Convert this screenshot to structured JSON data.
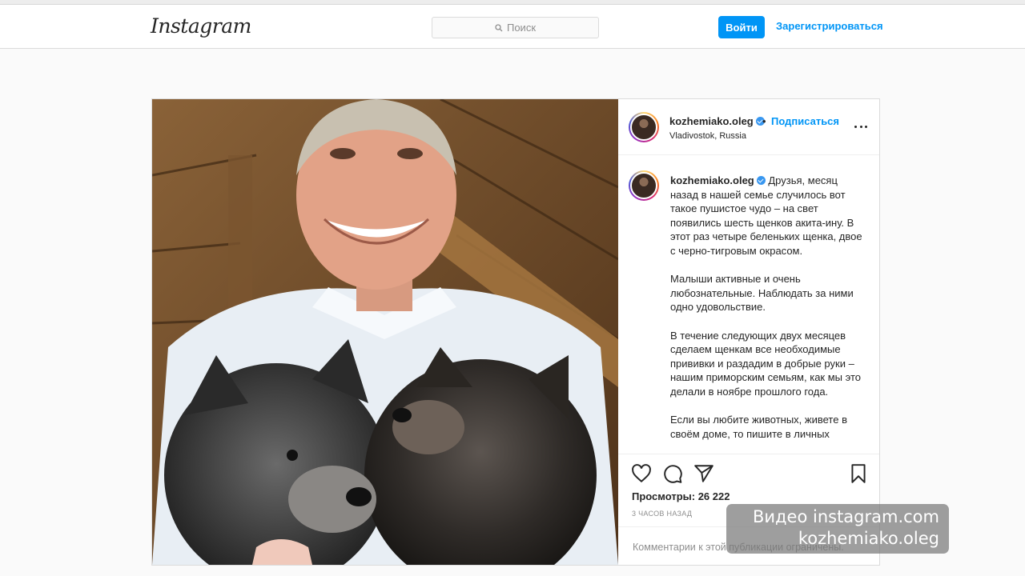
{
  "header": {
    "logo": "Instagram",
    "search": {
      "placeholder": "Поиск",
      "icon": "search-icon"
    },
    "login_label": "Войти",
    "signup_label": "Зарегистрироваться",
    "accent_color": "#0095f6"
  },
  "post": {
    "author": {
      "username": "kozhemiako.oleg",
      "verified": true,
      "separator": "•",
      "follow_label": "Подписаться",
      "location": "Vladivostok, Russia"
    },
    "caption": {
      "username": "kozhemiako.oleg",
      "paragraphs": [
        "Друзья, месяц назад в нашей семье случилось вот такое пушистое чудо – на свет появились шесть щенков акита-ину. В этот раз четыре беленьких щенка, двое с черно-тигровым окрасом.",
        "Малыши активные и очень любознательные. Наблюдать за ними одно удовольствие.",
        "В течение следующих двух месяцев сделаем щенкам все необходимые прививки и раздадим в добрые руки – нашим приморским семьям, как мы это делали в ноябре прошлого года.",
        "Если вы любите животных, живете в своём доме, то пишите в личных"
      ]
    },
    "actions": {
      "icons": [
        "heart-icon",
        "comment-icon",
        "share-icon",
        "bookmark-icon"
      ]
    },
    "views_text": "Просмотры: 26 222",
    "time_text": "3 ЧАСОВ НАЗАД",
    "comment_placeholder": "Комментарии к этой публикации ограничены."
  },
  "watermark": {
    "line1": "Видео instagram.com",
    "line2": "kozhemiako.oleg"
  }
}
